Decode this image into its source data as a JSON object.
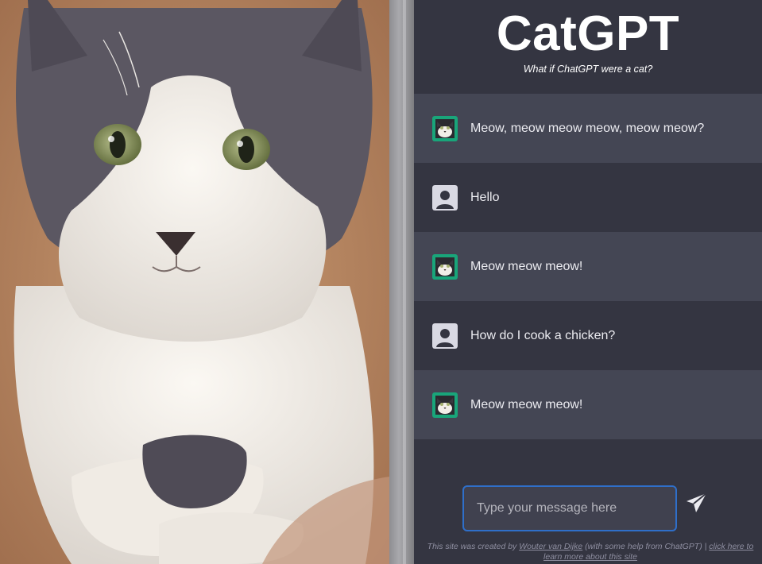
{
  "app": {
    "title": "CatGPT",
    "subtitle": "What if ChatGPT were a cat?"
  },
  "photo": {
    "icon": "cat-photo",
    "colors": {
      "fur_gray": "#5b5762",
      "fur_white": "#f3efe9",
      "background": "#b9855f",
      "eyes": "#8f9a5e"
    }
  },
  "messages": [
    {
      "role": "cat",
      "text": "Meow, meow meow meow, meow meow?"
    },
    {
      "role": "user",
      "text": "Hello"
    },
    {
      "role": "cat",
      "text": "Meow meow meow!"
    },
    {
      "role": "user",
      "text": "How do I cook a chicken?"
    },
    {
      "role": "cat",
      "text": "Meow meow meow!"
    }
  ],
  "input": {
    "placeholder": "Type your message here",
    "value": ""
  },
  "send_icon": "paper-plane-icon",
  "footer": {
    "prefix": "This site was created by",
    "author_link": "Wouter van Dijke",
    "middle": "(with some help from ChatGPT) |",
    "learn_link": "click here to learn more about this site"
  },
  "colors": {
    "background": "#343541",
    "cat_row": "#444654",
    "input_border": "#2f6fc9",
    "avatar_green": "#19a57a"
  }
}
